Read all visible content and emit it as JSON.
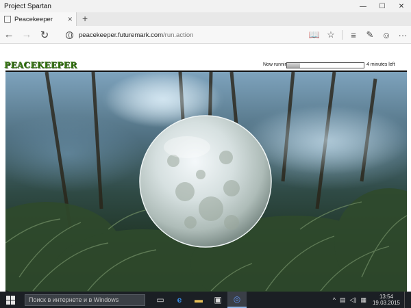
{
  "window": {
    "title": "Project Spartan",
    "minimize": "—",
    "maximize": "☐",
    "close": "✕"
  },
  "tab": {
    "label": "Peacekeeper",
    "close": "✕",
    "new_tab": "+"
  },
  "nav": {
    "back": "←",
    "forward": "→",
    "refresh": "↻",
    "address_host": "peacekeeper.futuremark.com",
    "address_path": "/run.action",
    "reading_view": "📖",
    "favorite": "☆",
    "hub": "≡",
    "note": "✎",
    "feedback": "☺",
    "more": "···"
  },
  "page": {
    "logo": "PEACEKEEPER",
    "running_label": "Now running",
    "progress_fraction": 0.17,
    "time_left": "4 minutes left"
  },
  "taskbar": {
    "search_placeholder": "Поиск в интернете и в Windows",
    "task_view": "▭",
    "edge": "e",
    "explorer": "▬",
    "store": "▣",
    "spartan": "◎",
    "tray_up": "^",
    "network": "▤",
    "volume": "◁)",
    "language": "▦",
    "time": "13:54",
    "date": "19.03.2015"
  },
  "colors": {
    "accent": "#2a6ebd",
    "logo_green": "#3b7a16",
    "taskbar": "#1b1f24"
  }
}
